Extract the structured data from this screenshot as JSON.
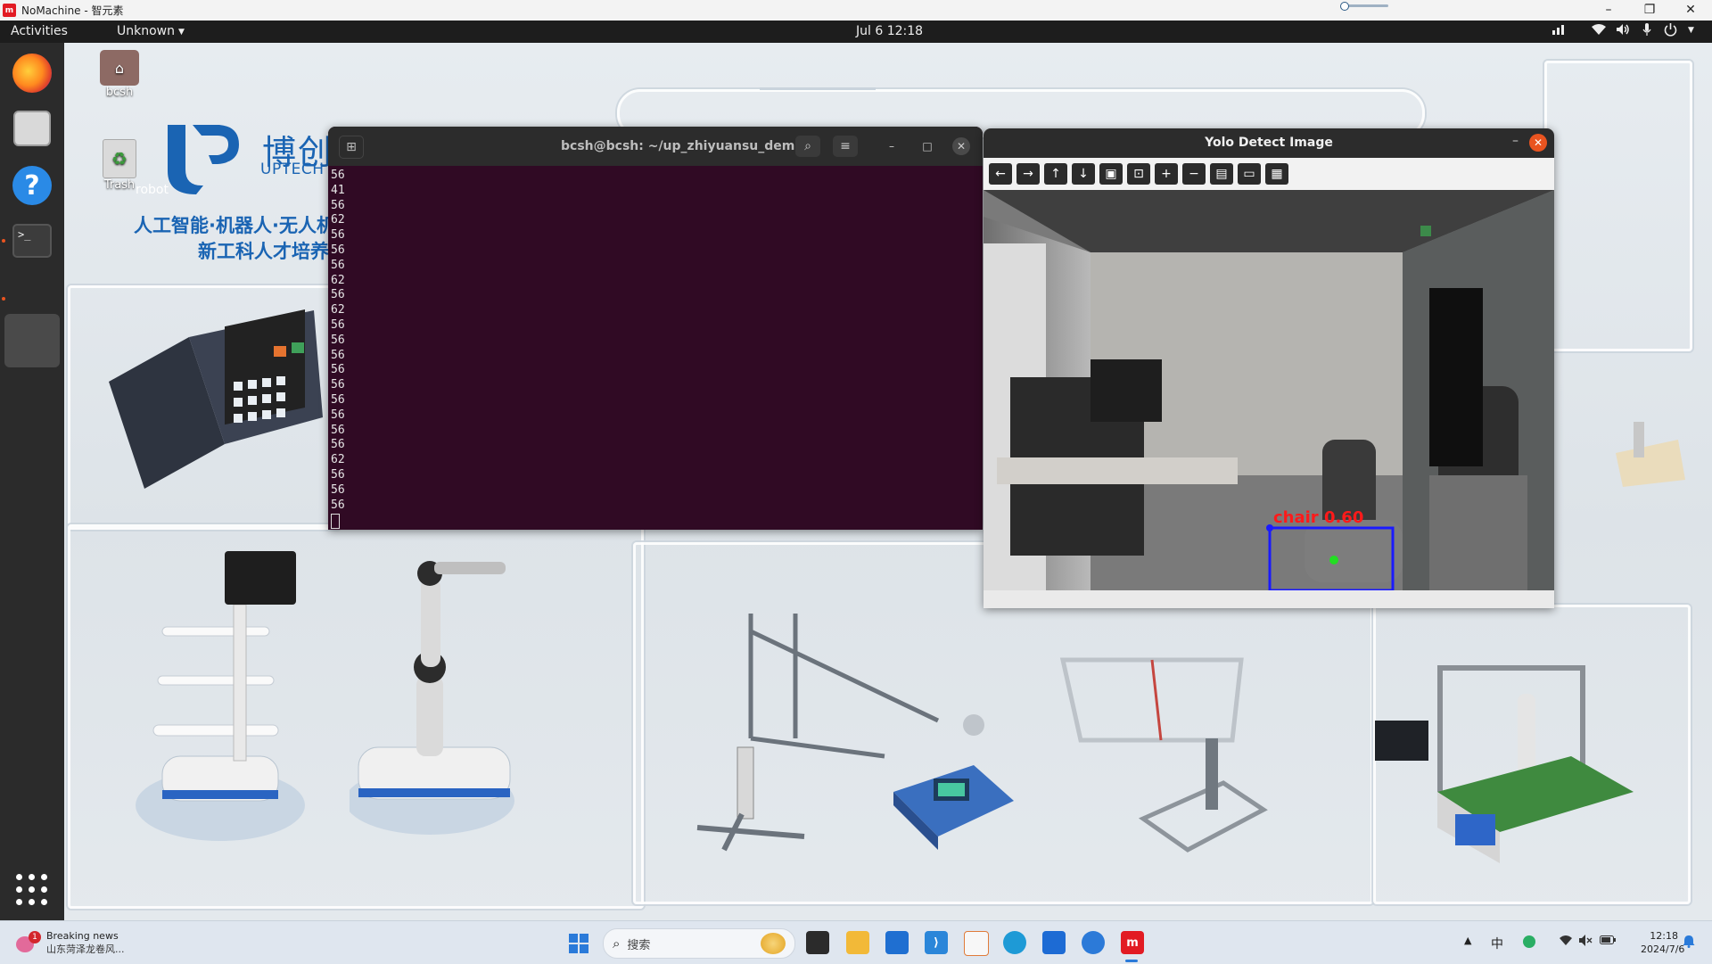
{
  "nomachine": {
    "title": "NoMachine - 智元素",
    "logo_text": "m",
    "controls": {
      "minimize": "–",
      "restore": "❐",
      "close": "✕"
    }
  },
  "topbar": {
    "activities": "Activities",
    "app_menu": "Unknown",
    "clock": "Jul 6  12:18",
    "tray_icons": [
      "network-wired-icon",
      "wifi-icon",
      "volume-icon",
      "microphone-icon",
      "power-icon",
      "dropdown-icon"
    ]
  },
  "dock": {
    "items": [
      "firefox",
      "files",
      "help",
      "terminal"
    ],
    "terminal_glyph": ">_",
    "help_glyph": "?"
  },
  "desktop": {
    "icons": [
      {
        "label": "bcsh",
        "icon": "home-folder-icon"
      },
      {
        "label": "Trash",
        "icon": "trash-icon"
      }
    ],
    "wallpaper": {
      "brand_cn": "博创尚和",
      "brand_en": "UPTECH HARMONY",
      "slogan_line1": "人工智能·机器人·无人机技",
      "slogan_line2": "新工科人才培养",
      "partial_text": "robot"
    }
  },
  "terminal": {
    "title": "bcsh@bcsh: ~/up_zhiyuansu_demo",
    "lines": [
      "56",
      "41",
      "56",
      "62",
      "56",
      "56",
      "56",
      "62",
      "56",
      "62",
      "56",
      "56",
      "56",
      "56",
      "56",
      "56",
      "56",
      "56",
      "56",
      "62",
      "56",
      "56",
      "56"
    ]
  },
  "yolo_window": {
    "title": "Yolo Detect Image",
    "toolbar": [
      {
        "name": "back",
        "glyph": "←"
      },
      {
        "name": "forward",
        "glyph": "→"
      },
      {
        "name": "up",
        "glyph": "↑"
      },
      {
        "name": "down",
        "glyph": "↓"
      },
      {
        "name": "image",
        "glyph": "▣"
      },
      {
        "name": "image-zoom",
        "glyph": "⊡"
      },
      {
        "name": "zoom-in",
        "glyph": "+"
      },
      {
        "name": "zoom-out",
        "glyph": "−"
      },
      {
        "name": "save",
        "glyph": "▤"
      },
      {
        "name": "copy",
        "glyph": "▭"
      },
      {
        "name": "properties",
        "glyph": "▦"
      }
    ],
    "detection": {
      "label": "chair",
      "confidence": "0.60",
      "box_color": "#1a1aff",
      "label_color": "#ff1a1a"
    }
  },
  "taskbar": {
    "news_badge": "1",
    "news_title": "Breaking news",
    "news_sub": "山东菏泽龙卷风...",
    "search_placeholder": "搜索",
    "apps": [
      "file-explorer-icon",
      "folder-icon",
      "store-icon",
      "vscode-icon",
      "office-icon",
      "edge-icon",
      "remote-desktop-icon",
      "feishu-icon",
      "nomachine-icon"
    ],
    "ime": "中",
    "time": "12:18",
    "date": "2024/7/6"
  },
  "colors": {
    "ubuntu_terminal_bg": "#300a24",
    "ubuntu_orange": "#e95420",
    "brand_blue": "#1a64b3",
    "nomachine_red": "#e21b23"
  }
}
